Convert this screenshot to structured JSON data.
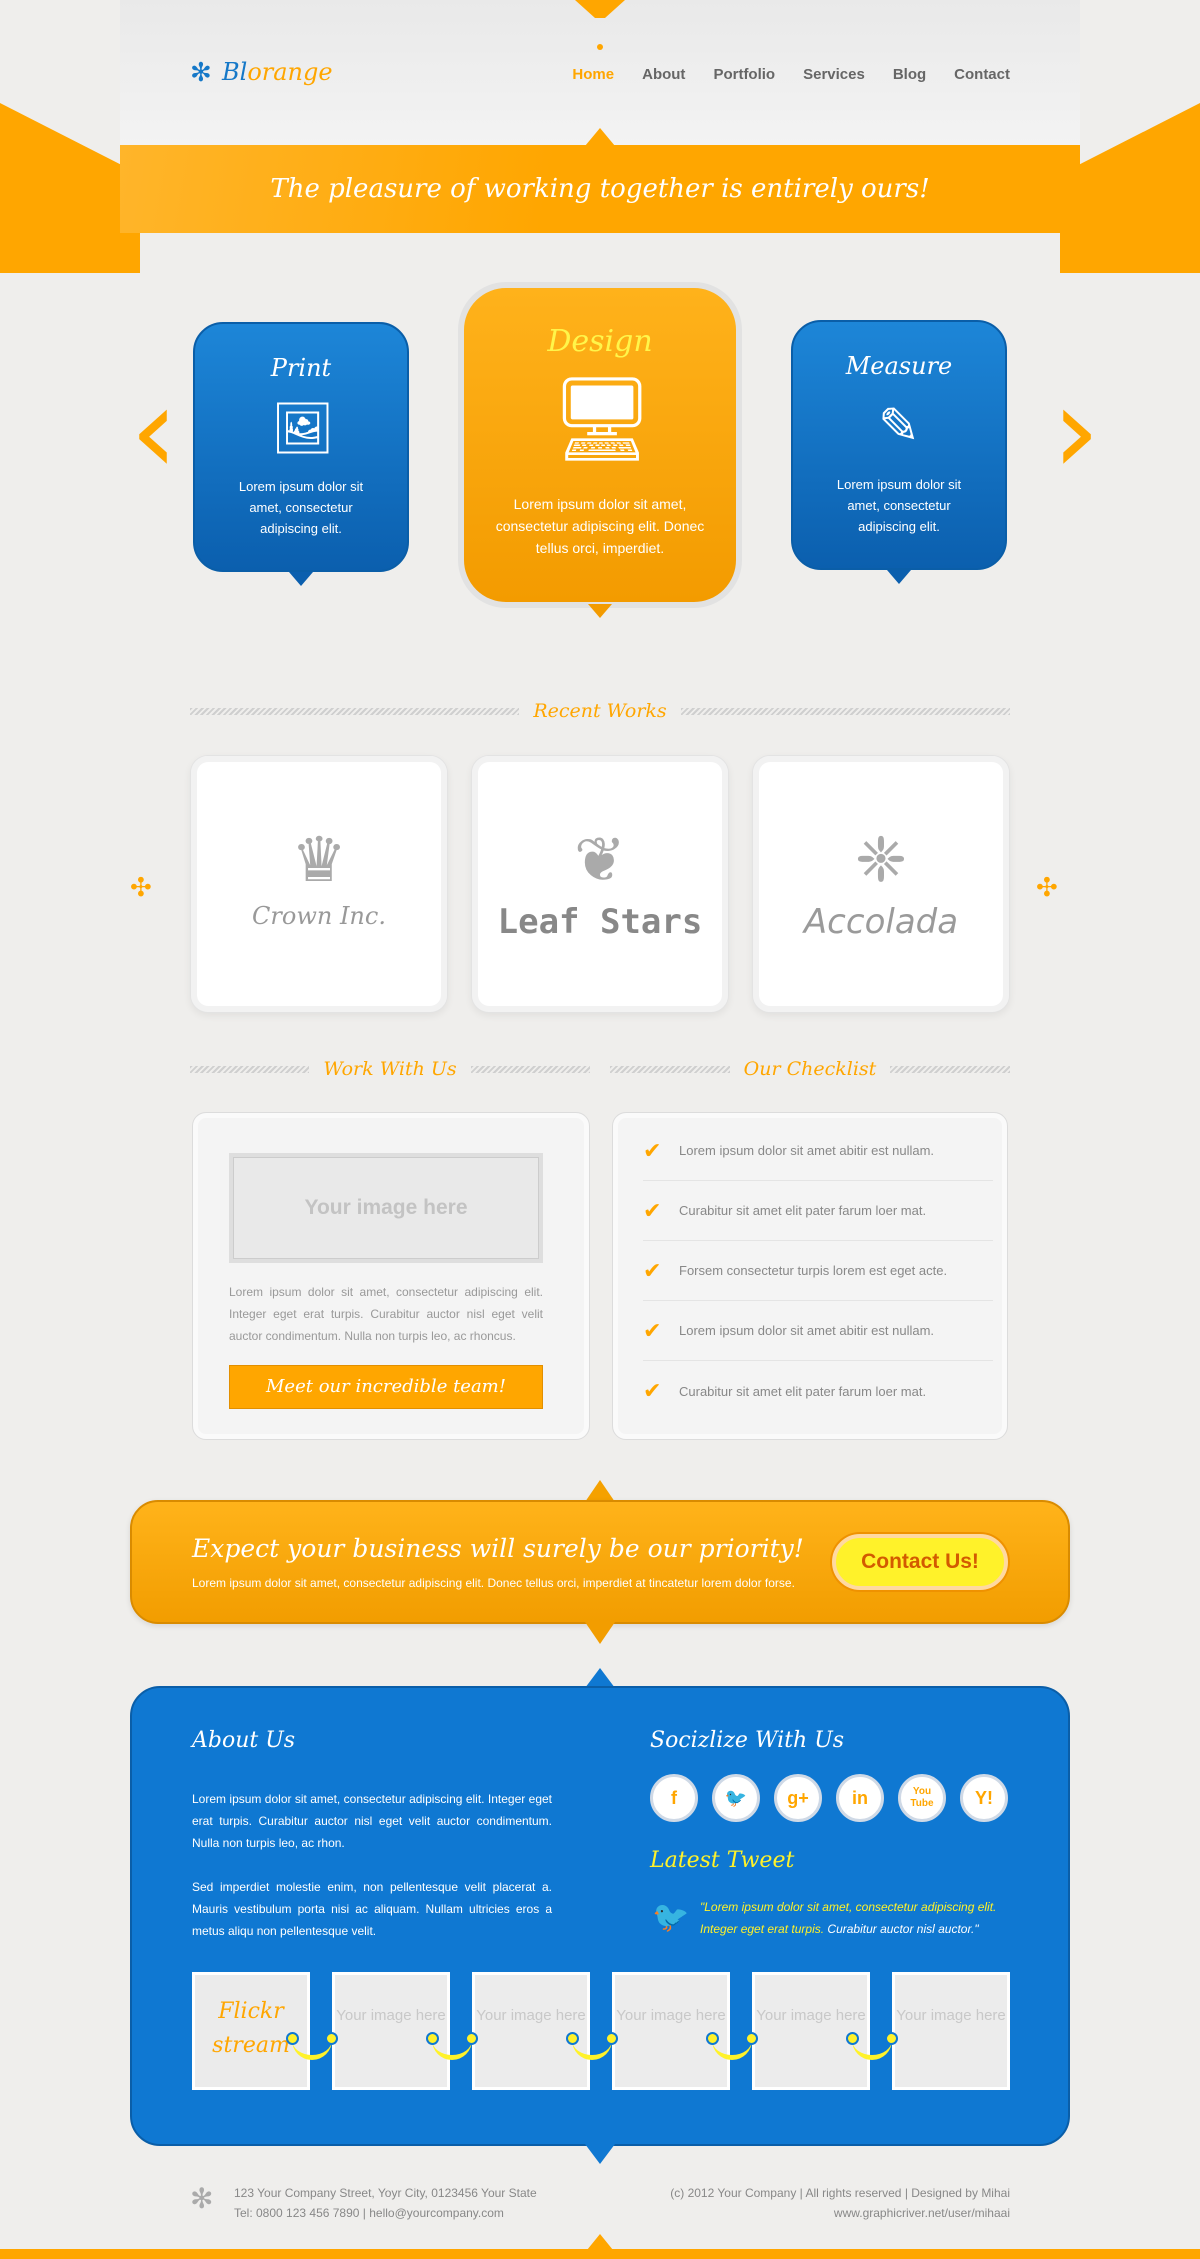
{
  "header": {
    "logo": {
      "part1": "Bl",
      "part2": "orange",
      "icon": "sun-flower-icon"
    },
    "nav": [
      {
        "label": "Home"
      },
      {
        "label": "About"
      },
      {
        "label": "Portfolio"
      },
      {
        "label": "Services"
      },
      {
        "label": "Blog"
      },
      {
        "label": "Contact"
      }
    ],
    "tagline": "The pleasure of working together is entirely ours!"
  },
  "services": [
    {
      "title": "Print",
      "icon": "picture-icon",
      "text": "Lorem ipsum dolor sit amet, consectetur adipiscing elit."
    },
    {
      "title": "Design",
      "icon": "monitor-icon",
      "text": "Lorem ipsum dolor sit amet, consectetur adipiscing elit. Donec tellus orci, imperdiet."
    },
    {
      "title": "Measure",
      "icon": "pencil-ruler-icon",
      "text": "Lorem ipsum dolor sit amet, consectetur adipiscing elit."
    }
  ],
  "recent": {
    "title": "Recent Works",
    "items": [
      {
        "label": "Crown Inc.",
        "icon": "crown-icon"
      },
      {
        "label": "Leaf Stars",
        "icon": "leaf-icon"
      },
      {
        "label": "Accolada",
        "icon": "ornament-icon"
      }
    ]
  },
  "work_with_us": {
    "title": "Work With Us",
    "image_placeholder": "Your image here",
    "text": "Lorem ipsum dolor sit amet, consectetur adipiscing elit. Integer eget erat turpis. Curabitur auctor nisl eget velit auctor condimentum. Nulla non turpis leo, ac rhoncus.",
    "button": "Meet our incredible team!"
  },
  "checklist": {
    "title": "Our Checklist",
    "items": [
      "Lorem ipsum dolor sit amet abitir est nullam.",
      "Curabitur sit amet elit pater farum loer mat.",
      "Forsem consectetur turpis lorem est eget acte.",
      "Lorem ipsum dolor sit amet abitir est nullam.",
      "Curabitur sit amet elit pater farum loer mat."
    ]
  },
  "cta": {
    "headline": "Expect your business will surely be our priority!",
    "sub": "Lorem ipsum dolor sit amet, consectetur adipiscing elit. Donec tellus orci, imperdiet at tincatetur lorem dolor forse.",
    "button": "Contact Us!"
  },
  "about": {
    "title": "About Us",
    "p1": "Lorem ipsum dolor sit amet, consectetur adipiscing elit. Integer eget erat turpis. Curabitur auctor nisl eget velit auctor condimentum. Nulla non turpis leo, ac rhon.",
    "p2": "Sed imperdiet molestie enim, non pellentesque velit placerat a. Mauris vestibulum porta nisi ac aliquam. Nullam ultricies eros a metus aliqu non pellentesque velit."
  },
  "social": {
    "title": "Socizlize With Us",
    "items": [
      {
        "glyph": "f",
        "icon": "facebook-icon"
      },
      {
        "glyph": "t",
        "icon": "twitter-icon"
      },
      {
        "glyph": "g+",
        "icon": "google-plus-icon"
      },
      {
        "glyph": "in",
        "icon": "linkedin-icon"
      },
      {
        "glyph": "You Tube",
        "icon": "youtube-icon"
      },
      {
        "glyph": "Y!",
        "icon": "yahoo-icon"
      }
    ]
  },
  "tweet": {
    "title": "Latest Tweet",
    "text_yellow": "\"Lorem ipsum dolor sit amet, consectetur adipiscing elit. Integer eget erat turpis.",
    "text_white": " Curabitur auctor nisl auctor.\""
  },
  "flickr": {
    "title_line1": "Flickr",
    "title_line2": "stream",
    "placeholder": "Your image here"
  },
  "footer": {
    "address": "123 Your Company Street, Yoyr City, 0123456 Your State",
    "contact": "Tel: 0800 123 456 7890 | hello@yourcompany.com",
    "copyright": "(c) 2012 Your Company | All rights reserved | Designed by Mihai",
    "url": "www.graphicriver.net/user/mihaai"
  }
}
